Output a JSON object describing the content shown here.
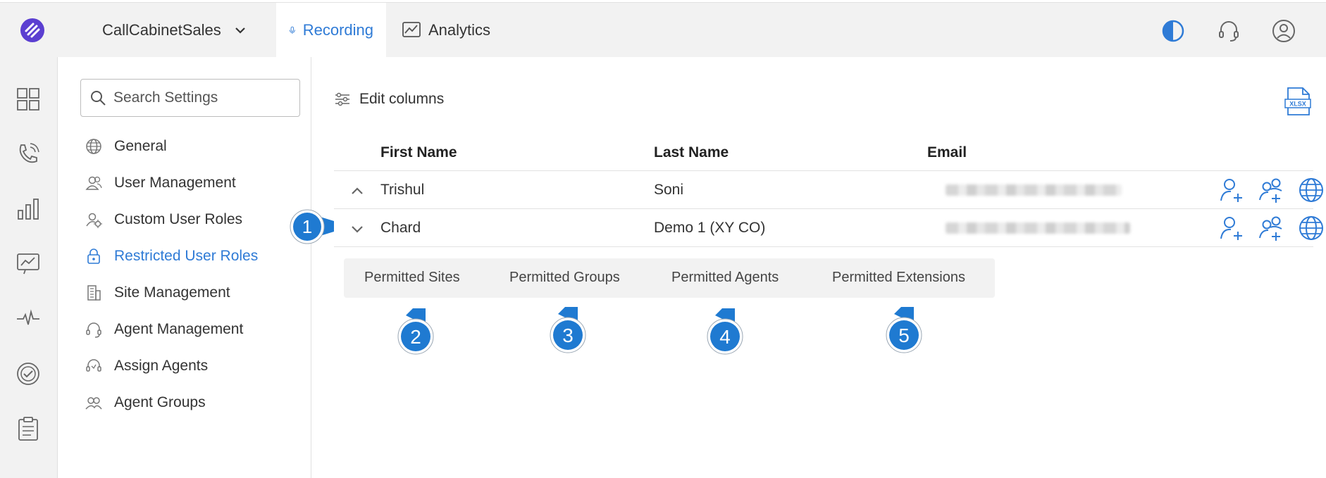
{
  "topbar": {
    "tenant": "CallCabinetSales",
    "tabs": [
      {
        "label": "Recording",
        "active": true
      },
      {
        "label": "Analytics",
        "active": false
      }
    ]
  },
  "settings": {
    "search_placeholder": "Search Settings",
    "items": [
      {
        "label": "General",
        "icon": "globe-icon"
      },
      {
        "label": "User Management",
        "icon": "users-icon"
      },
      {
        "label": "Custom User Roles",
        "icon": "user-gear-icon"
      },
      {
        "label": "Restricted User Roles",
        "icon": "lock-icon",
        "active": true
      },
      {
        "label": "Site Management",
        "icon": "building-icon"
      },
      {
        "label": "Agent Management",
        "icon": "headset-icon"
      },
      {
        "label": "Assign Agents",
        "icon": "headset-assign-icon"
      },
      {
        "label": "Agent Groups",
        "icon": "agent-group-icon"
      }
    ]
  },
  "main": {
    "edit_columns": "Edit columns",
    "export_label": "XLSX",
    "columns": [
      "First Name",
      "Last Name",
      "Email"
    ],
    "rows": [
      {
        "first": "Trishul",
        "last": "Soni",
        "expanded": true
      },
      {
        "first": "Chard",
        "last": "Demo 1 (XY CO)",
        "expanded": false
      }
    ],
    "permission_tabs": [
      "Permitted Sites",
      "Permitted Groups",
      "Permitted Agents",
      "Permitted Extensions"
    ]
  },
  "callouts": [
    "1",
    "2",
    "3",
    "4",
    "5"
  ],
  "colors": {
    "accent": "#2f7bd6",
    "callout": "#1f7ad1",
    "logo": "#5b3fd1"
  }
}
